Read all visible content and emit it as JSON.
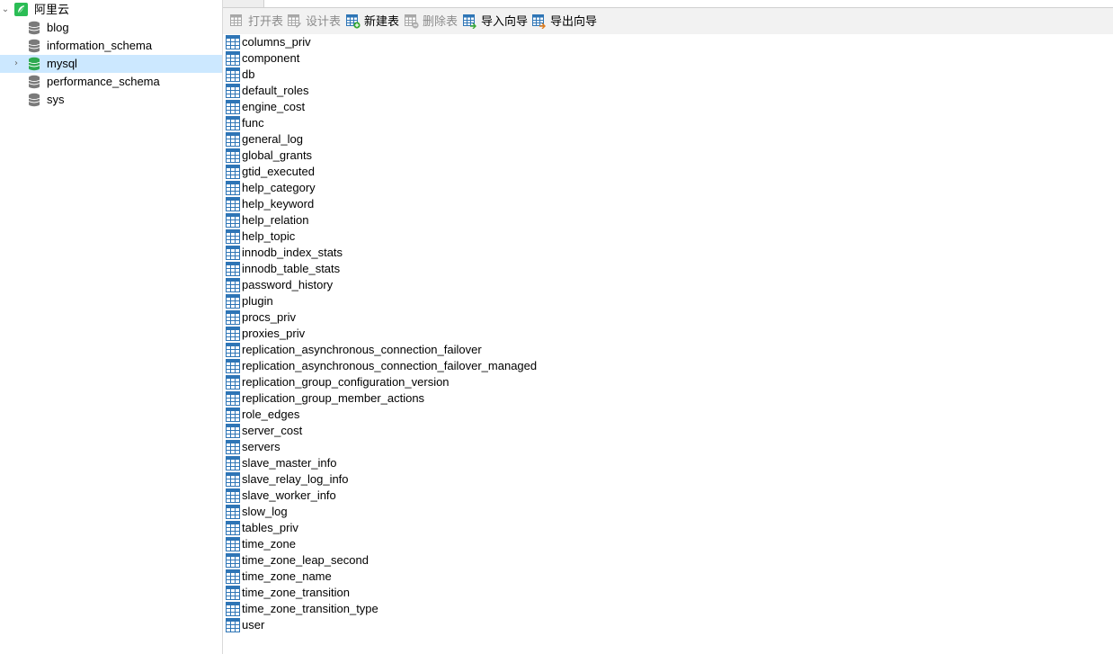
{
  "colors": {
    "selection": "#cce8ff",
    "toolbar_bg": "#f2f2f2",
    "connection_green": "#2bbd55",
    "table_icon_blue": "#2e75b6",
    "db_icon_gray": "#7a7a7a",
    "db_icon_green": "#2da94f"
  },
  "sidebar": {
    "connection": {
      "label": "阿里云",
      "icon": "connection-icon",
      "expanded": true
    },
    "databases": [
      {
        "label": "blog",
        "icon": "database-icon",
        "active": false,
        "selected": false
      },
      {
        "label": "information_schema",
        "icon": "database-icon",
        "active": false,
        "selected": false
      },
      {
        "label": "mysql",
        "icon": "database-icon",
        "active": true,
        "selected": true
      },
      {
        "label": "performance_schema",
        "icon": "database-icon",
        "active": false,
        "selected": false
      },
      {
        "label": "sys",
        "icon": "database-icon",
        "active": false,
        "selected": false
      }
    ]
  },
  "toolbar": {
    "buttons": [
      {
        "label": "打开表",
        "icon": "open-table-icon",
        "enabled": false
      },
      {
        "label": "设计表",
        "icon": "design-table-icon",
        "enabled": false
      },
      {
        "label": "新建表",
        "icon": "new-table-icon",
        "enabled": true
      },
      {
        "label": "删除表",
        "icon": "delete-table-icon",
        "enabled": false
      },
      {
        "label": "导入向导",
        "icon": "import-wizard-icon",
        "enabled": true
      },
      {
        "label": "导出向导",
        "icon": "export-wizard-icon",
        "enabled": true
      }
    ]
  },
  "tables": [
    "columns_priv",
    "component",
    "db",
    "default_roles",
    "engine_cost",
    "func",
    "general_log",
    "global_grants",
    "gtid_executed",
    "help_category",
    "help_keyword",
    "help_relation",
    "help_topic",
    "innodb_index_stats",
    "innodb_table_stats",
    "password_history",
    "plugin",
    "procs_priv",
    "proxies_priv",
    "replication_asynchronous_connection_failover",
    "replication_asynchronous_connection_failover_managed",
    "replication_group_configuration_version",
    "replication_group_member_actions",
    "role_edges",
    "server_cost",
    "servers",
    "slave_master_info",
    "slave_relay_log_info",
    "slave_worker_info",
    "slow_log",
    "tables_priv",
    "time_zone",
    "time_zone_leap_second",
    "time_zone_name",
    "time_zone_transition",
    "time_zone_transition_type",
    "user"
  ]
}
